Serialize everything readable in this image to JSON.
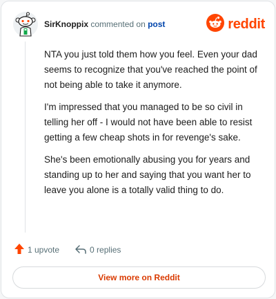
{
  "comment": {
    "username": "SirKnoppix",
    "action_text": "commented on",
    "post_link": "post",
    "brand": "reddit",
    "paragraphs": [
      "NTA you just told them how you feel. Even your dad seems to recognize that you've reached the point of not being able to take it anymore.",
      "I'm impressed that you managed to be so civil in telling her off - I would not have been able to resist getting a few cheap shots in for revenge's sake.",
      "She's been emotionally abusing you for years and standing up to her and saying that you want her to leave you alone is a totally valid thing to do."
    ],
    "upvotes_label": "1 upvote",
    "replies_label": "0 replies",
    "view_more_label": "View more on Reddit"
  },
  "icons": {
    "avatar": "snoo-avatar-icon",
    "logo": "reddit-logo-icon",
    "upvote": "upvote-arrow-icon",
    "reply": "reply-arrow-icon"
  },
  "colors": {
    "brand": "#ff4500",
    "link": "#0045ac",
    "view_more": "#d93a00",
    "muted": "#576f76"
  }
}
